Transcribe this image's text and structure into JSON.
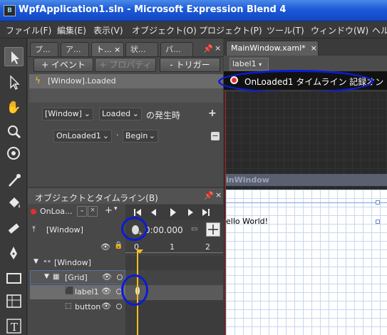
{
  "window": {
    "app_icon": "blend-app-icon",
    "title": "WpfApplication1.sln - Microsoft Expression Blend 4"
  },
  "menu": [
    "ファイル(F)",
    "編集(E)",
    "表示(V)",
    "オブジェクト(O)",
    "プロジェクト(P)",
    "ツール(T)",
    "ウィンドウ(W)",
    "ヘル"
  ],
  "triggers_panel": {
    "tabs": [
      "プ...",
      "ア...",
      "ト...",
      "状...",
      "パ..."
    ],
    "close_glyph": "×",
    "pin_glyph": "▾",
    "add_event_label": "+ イベント",
    "add_property_label": "+ プロパティ",
    "remove_trigger_label": "- トリガー",
    "selected_trigger": "[Window].Loaded",
    "condition_source": "[Window]",
    "condition_event": "Loaded",
    "condition_suffix": "の発生時",
    "add_glyph": "+",
    "action_target": "OnLoaded1",
    "action_dot": "·",
    "action_verb": "Begin",
    "remove_glyph": "−"
  },
  "objects_panel": {
    "title": "オブジェクトとタイムライン(B)",
    "close_glyph": "×",
    "storyboard": "OnLoa...",
    "window_item": "[Window]",
    "time_display": "0:00.000",
    "ruler_ticks": [
      "0",
      "1",
      "2"
    ],
    "tree": [
      {
        "label": "[Window]",
        "depth": 0
      },
      {
        "label": "[Grid]",
        "depth": 1
      },
      {
        "label": "label1",
        "depth": 2
      },
      {
        "label": "button",
        "depth": 2
      }
    ]
  },
  "document": {
    "tab_label": "MainWindow.xaml*",
    "close_glyph": "×",
    "breadcrumb": "label1",
    "recording_text": "OnLoaded1 タイムライン 記録オン",
    "window_caption": "inWindow",
    "hello_text": "ello World!"
  },
  "colors": {
    "highlight": "#0b1bd6",
    "record": "#e03030",
    "playhead": "#f0c020",
    "artboard_border": "#c02020"
  },
  "icons": [
    "selection-icon",
    "direct-select-icon",
    "pan-icon",
    "zoom-icon",
    "camera-orbit-icon",
    "eyedropper-icon",
    "paint-bucket-icon",
    "brush-transform-icon",
    "pen-icon",
    "rectangle-icon",
    "grid-layout-icon",
    "text-icon"
  ]
}
